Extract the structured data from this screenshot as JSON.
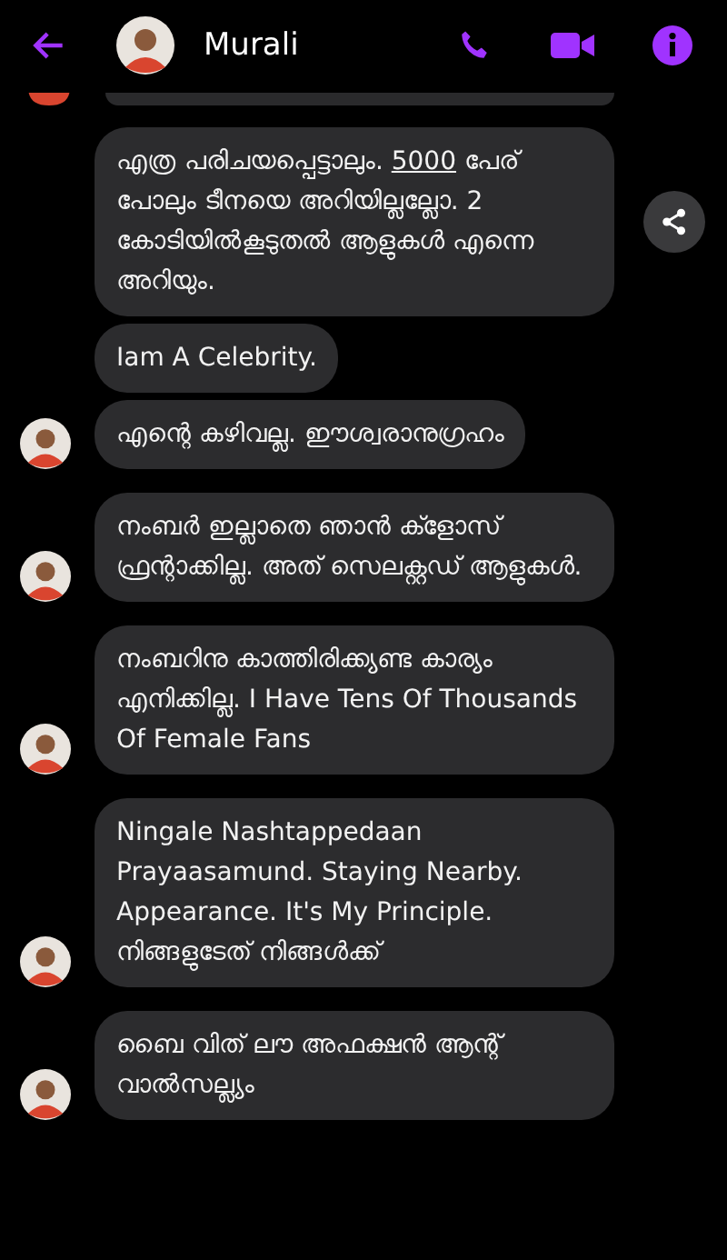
{
  "header": {
    "name": "Murali"
  },
  "groups": [
    {
      "messages": [
        {
          "parts": [
            {
              "kind": "plain",
              "text": "എത്ര പരിചയപ്പെട്ടാലും. "
            },
            {
              "kind": "link",
              "text": "5000"
            },
            {
              "kind": "plain",
              "text": " പേര് പോലും ടീനയെ അറിയില്ലല്ലോ. 2 കോടിയിൽകൂടുതൽ ആളുകൾ എന്നെ അറിയും."
            }
          ],
          "share": true
        },
        {
          "parts": [
            {
              "kind": "plain",
              "text": "Iam A Celebrity."
            }
          ],
          "share": false
        },
        {
          "parts": [
            {
              "kind": "plain",
              "text": "എന്റെ കഴിവല്ല. ഈശ്വരാനുഗ്രഹം"
            }
          ],
          "share": false
        }
      ]
    },
    {
      "messages": [
        {
          "parts": [
            {
              "kind": "plain",
              "text": "നംബർ ഇല്ലാതെ ഞാൻ ക്ളോസ് ഫ്രന്റാക്കില്ല. അത് സെലക്റ്റഡ് ആളുകൾ."
            }
          ],
          "share": false
        }
      ]
    },
    {
      "messages": [
        {
          "parts": [
            {
              "kind": "plain",
              "text": "നംബറിനു കാത്തിരിക്ക്യണ്ട കാര്യം എനിക്കില്ല. I Have Tens Of Thousands Of Female Fans"
            }
          ],
          "share": false
        }
      ]
    },
    {
      "messages": [
        {
          "parts": [
            {
              "kind": "plain",
              "text": "Ningale Nashtappedaan Prayaasamund. Staying Nearby. Appearance. It's My Principle. നിങ്ങളുടേത് നിങ്ങൾക്ക്"
            }
          ],
          "share": false
        }
      ]
    },
    {
      "messages": [
        {
          "parts": [
            {
              "kind": "plain",
              "text": "ബൈ വിത് ലൗ അഫക്ഷൻ ആന്റ് വാൽസല്ല്യം"
            }
          ],
          "share": false
        }
      ]
    }
  ]
}
